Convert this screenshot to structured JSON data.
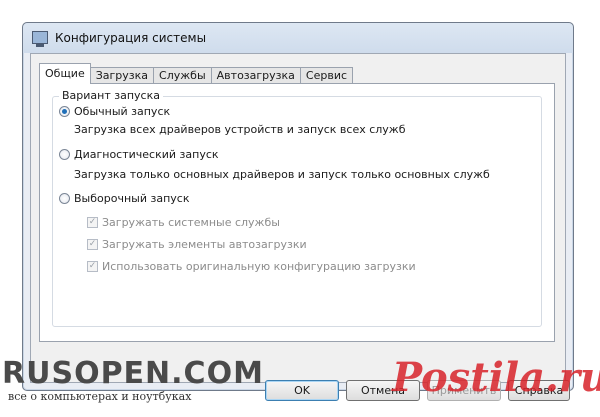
{
  "window": {
    "title": "Конфигурация системы"
  },
  "tabs": [
    {
      "label": "Общие",
      "active": true
    },
    {
      "label": "Загрузка",
      "active": false
    },
    {
      "label": "Службы",
      "active": false
    },
    {
      "label": "Автозагрузка",
      "active": false
    },
    {
      "label": "Сервис",
      "active": false
    }
  ],
  "startup": {
    "group_label": "Вариант запуска",
    "options": [
      {
        "label": "Обычный запуск",
        "description": "Загрузка всех драйверов устройств и запуск всех служб",
        "selected": true
      },
      {
        "label": "Диагностический запуск",
        "description": "Загрузка только основных драйверов и запуск только основных служб",
        "selected": false
      },
      {
        "label": "Выборочный запуск",
        "selected": false
      }
    ],
    "selective_items": [
      {
        "label": "Загружать системные службы",
        "checked": true,
        "enabled": false
      },
      {
        "label": "Загружать элементы автозагрузки",
        "checked": true,
        "enabled": false
      },
      {
        "label": "Использовать оригинальную конфигурацию загрузки",
        "checked": true,
        "enabled": false
      }
    ]
  },
  "buttons": {
    "ok": "OK",
    "cancel": "Отмена",
    "apply": "Применить",
    "help": "Справка"
  },
  "watermarks": {
    "left_main": "RUSOPEN.COM",
    "left_sub": "все о компьютерах и ноутбуках",
    "right": "Postila.ru"
  }
}
